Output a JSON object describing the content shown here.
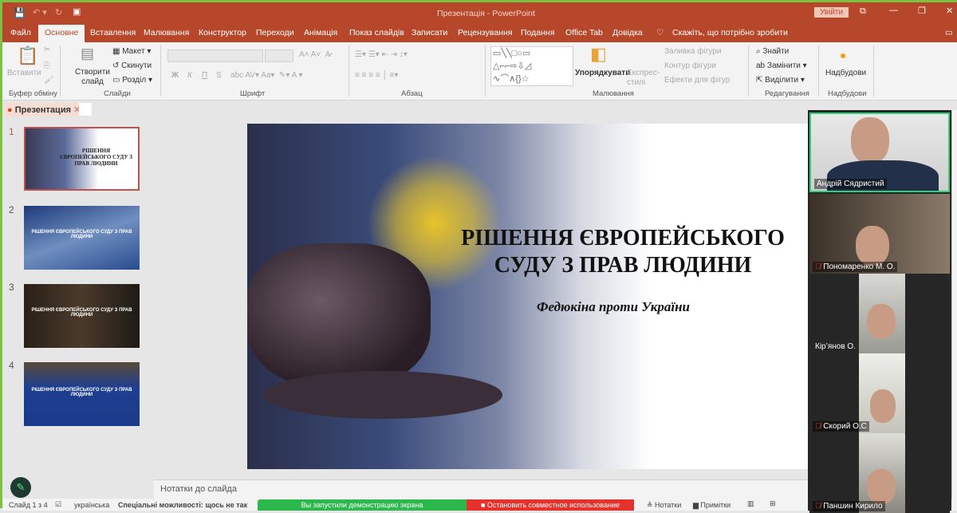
{
  "titlebar": {
    "title": "Презентація - PowerPoint",
    "signin": "Увійти"
  },
  "tabs": [
    "Файл",
    "Основне",
    "Вставлення",
    "Малювання",
    "Конструктор",
    "Переходи",
    "Анімація",
    "Показ слайдів",
    "Записати",
    "Рецензування",
    "Подання",
    "Office Tab",
    "Довідка"
  ],
  "tell_me": "Скажіть, що потрібно зробити",
  "ribbon": {
    "clipboard": {
      "paste": "Вставити",
      "group": "Буфер обміну"
    },
    "slides": {
      "new_slide": "Створити слайд",
      "layout": "Макет",
      "reset": "Скинути",
      "section": "Розділ",
      "group": "Слайди"
    },
    "font": {
      "group": "Шрифт",
      "bold": "Ж",
      "italic": "К",
      "underline": "П",
      "shadow": "S"
    },
    "paragraph": {
      "group": "Абзац"
    },
    "drawing": {
      "arrange": "Упорядкувати",
      "quick_styles": "Експрес-стилі",
      "fill": "Заливка фігури",
      "outline": "Контур фігури",
      "effects": "Ефекти для фігур",
      "group": "Малювання"
    },
    "editing": {
      "find": "Знайти",
      "replace": "Замінити",
      "select": "Виділити",
      "group": "Редагування"
    },
    "addins": {
      "label": "Надбудови",
      "group": "Надбудови"
    }
  },
  "doc_tab": "Презентация",
  "thumbnails": [
    {
      "num": "1",
      "title": "РІШЕННЯ ЄВРОПЕЙСЬКОГО СУДУ З ПРАВ ЛЮДИНИ"
    },
    {
      "num": "2",
      "title": "РІШЕННЯ ЄВРОПЕЙСЬКОГО СУДУ З ПРАВ ЛЮДИНИ"
    },
    {
      "num": "3",
      "title": "РІШЕННЯ ЄВРОПЕЙСЬКОГО СУДУ З ПРАВ ЛЮДИНИ"
    },
    {
      "num": "4",
      "title": "РІШЕННЯ ЄВРОПЕЙСЬКОГО СУДУ З ПРАВ ЛЮДИНИ"
    }
  ],
  "slide": {
    "title_line1": "РІШЕННЯ ЄВРОПЕЙСЬКОГО",
    "title_line2": "СУДУ З ПРАВ ЛЮДИНИ",
    "subtitle": "Федюкіна проти України"
  },
  "notes_placeholder": "Нотатки до слайда",
  "status": {
    "slide_count": "Слайд 1 з 4",
    "language": "українська",
    "accessibility": "Спеціальні можливості: щось не так",
    "sharing": "Вы запустили демонстрацию экрана",
    "stop_sharing": "Остановить совместное использование",
    "notes": "Нотатки",
    "comments": "Примітки"
  },
  "participants": [
    {
      "name": "Андрій Сядристий",
      "muted": false
    },
    {
      "name": "Пономаренко М. О.",
      "muted": true
    },
    {
      "name": "Кір’янов О.",
      "muted": false
    },
    {
      "name": "Скорий О.С",
      "muted": true
    },
    {
      "name": "Паншин Кирило",
      "muted": true
    }
  ],
  "colors": {
    "accent": "#b7472a",
    "share_green": "#2db84d",
    "stop_red": "#e5322d"
  }
}
